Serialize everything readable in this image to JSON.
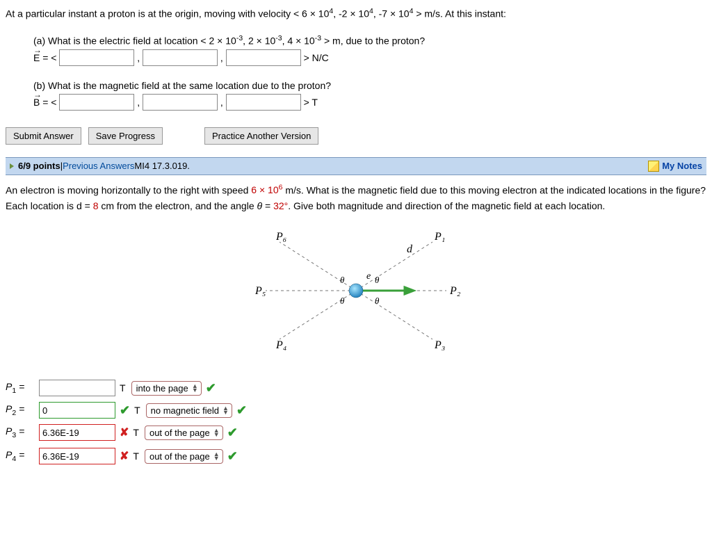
{
  "q1": {
    "intro_pre": "At a particular instant a proton is at the origin, moving with velocity < ",
    "v1": "6 × 10",
    "v1e": "4",
    "sep": ", ",
    "v2": "-2 × 10",
    "v2e": "4",
    "v3": "-7 × 10",
    "v3e": "4",
    "intro_post": " > m/s. At this instant:",
    "a_pre": "(a) What is the electric field at location < ",
    "a1": "2 × 10",
    "a1e": "-3",
    "a2": "2 × 10",
    "a2e": "-3",
    "a3": "4 × 10",
    "a3e": "-3",
    "a_post": " > m, due to the proton?",
    "E_label": "E",
    "eq": " = < ",
    "comma": " , ",
    "E_unit": " > N/C",
    "b_text": "(b) What is the magnetic field at the same location due to the proton?",
    "B_label": "B",
    "B_unit": " > T"
  },
  "buttons": {
    "submit": "Submit Answer",
    "save": "Save Progress",
    "practice": "Practice Another Version"
  },
  "header2": {
    "points": "6/9 points",
    "bar": " | ",
    "prev": "Previous Answers",
    "code": " MI4 17.3.019.",
    "notes": "My Notes"
  },
  "q2": {
    "t1": "An electron is moving horizontally to the right with speed ",
    "speed": "6 × 10",
    "speed_e": "6",
    "t2": " m/s. What is the magnetic field due to this moving electron at the indicated locations in the figure? Each location is d = ",
    "d": "8",
    "t3": " cm from the electron, and the angle ",
    "theta_sym": "θ",
    "t4": " = ",
    "theta": "32°",
    "t5": ". Give both magnitude and direction of the magnetic field at each location."
  },
  "fig": {
    "P1": "P₁",
    "P2": "P₂",
    "P3": "P₃",
    "P4": "P₄",
    "P5": "P₅",
    "P6": "P₆",
    "d": "d",
    "e": "e",
    "theta": "θ"
  },
  "answers": {
    "unit": "T",
    "rows": [
      {
        "label": "P₁ =",
        "val": "",
        "val_status": "",
        "dir": "into the page",
        "dir_check": true
      },
      {
        "label": "P₂ =",
        "val": "0",
        "val_status": "right",
        "dir": "no magnetic field",
        "dir_check": true
      },
      {
        "label": "P₃ =",
        "val": "6.36E-19",
        "val_status": "wrong",
        "dir": "out of the page",
        "dir_check": true
      },
      {
        "label": "P₄ =",
        "val": "6.36E-19",
        "val_status": "wrong",
        "dir": "out of the page",
        "dir_check": true
      }
    ]
  }
}
